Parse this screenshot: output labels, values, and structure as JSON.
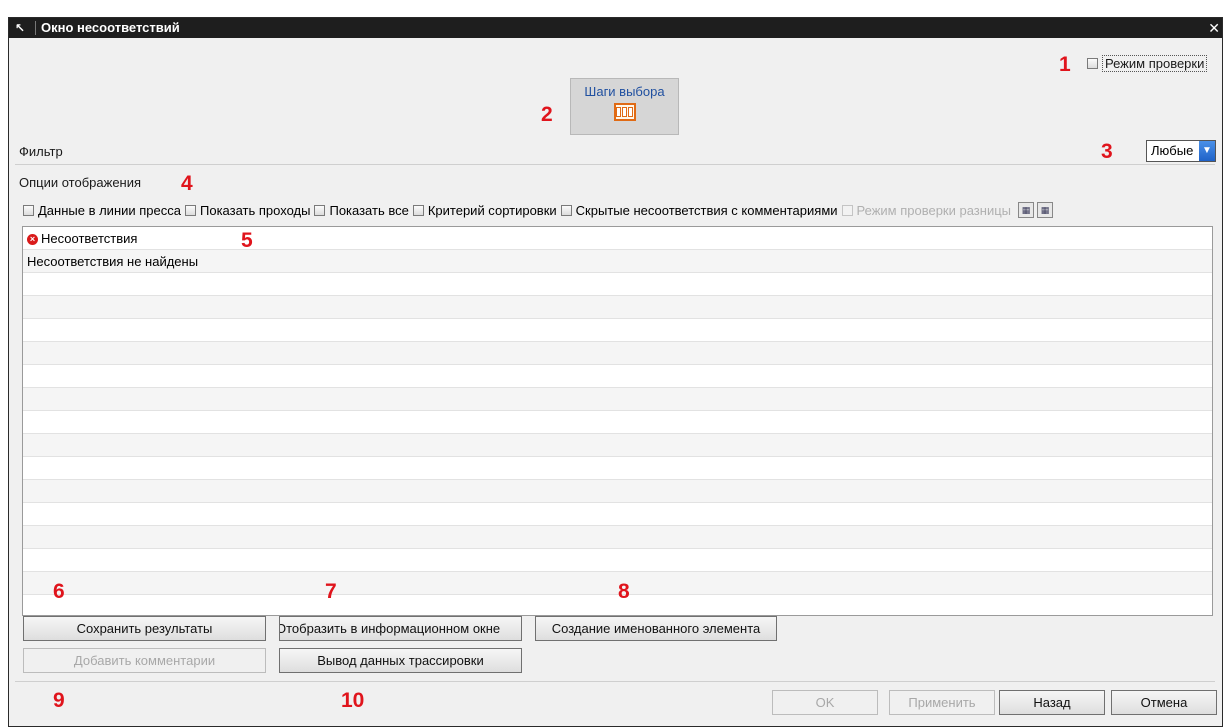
{
  "window": {
    "title": "Окно несоответствий",
    "close_glyph": "✕"
  },
  "check_mode": {
    "label": "Режим проверки",
    "checked": false
  },
  "steps": {
    "label": "Шаги выбора"
  },
  "filter": {
    "label": "Фильтр",
    "selected": "Любые"
  },
  "display_options": {
    "title": "Опции отображения",
    "checkboxes": [
      {
        "label": "Данные в линии пресса",
        "enabled": true
      },
      {
        "label": "Показать проходы",
        "enabled": true
      },
      {
        "label": "Показать все",
        "enabled": true
      },
      {
        "label": "Критерий сортировки",
        "enabled": true
      },
      {
        "label": "Скрытые несоответствия с комментариями",
        "enabled": true
      },
      {
        "label": "Режим проверки разницы",
        "enabled": false
      }
    ]
  },
  "list": {
    "header": "Несоответствия",
    "message": "Несоответствия не найдены"
  },
  "buttons": {
    "save_results": "Сохранить результаты",
    "show_info_window": "Отобразить в информационном окне",
    "create_named_element": "Создание именованного элемента",
    "add_comments": "Добавить комментарии",
    "trace_output": "Вывод данных трассировки",
    "ok": "OK",
    "apply": "Применить",
    "back": "Назад",
    "cancel": "Отмена"
  },
  "annotations": [
    "1",
    "2",
    "3",
    "4",
    "5",
    "6",
    "7",
    "8",
    "9",
    "10"
  ],
  "colors": {
    "annotation": "#e0141c",
    "titlebar": "#1e1e1e",
    "accent": "#1f62c8"
  }
}
